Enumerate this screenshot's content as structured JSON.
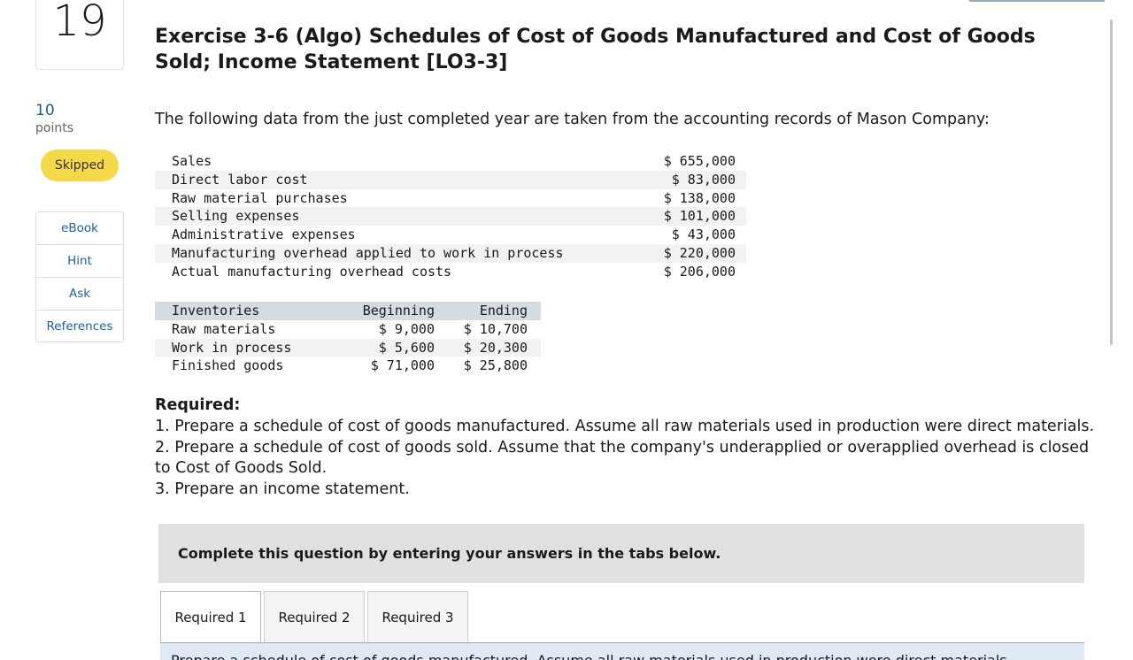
{
  "question": {
    "number": "19",
    "points_value": "10",
    "points_label": "points",
    "status": "Skipped"
  },
  "sidebar": {
    "links": [
      {
        "label": "eBook"
      },
      {
        "label": "Hint"
      },
      {
        "label": "Ask"
      },
      {
        "label": "References"
      }
    ]
  },
  "title": "Exercise 3-6 (Algo) Schedules of Cost of Goods Manufactured and Cost of Goods Sold; Income Statement [LO3-3]",
  "intro": "The following data from the just completed year are taken from the accounting records of Mason Company:",
  "data_rows": [
    {
      "label": "Sales",
      "value": "$ 655,000"
    },
    {
      "label": "Direct labor cost",
      "value": "$ 83,000"
    },
    {
      "label": "Raw material purchases",
      "value": "$ 138,000"
    },
    {
      "label": "Selling expenses",
      "value": "$ 101,000"
    },
    {
      "label": "Administrative expenses",
      "value": "$ 43,000"
    },
    {
      "label": "Manufacturing overhead applied to work in process",
      "value": "$ 220,000"
    },
    {
      "label": "Actual manufacturing overhead costs",
      "value": "$ 206,000"
    }
  ],
  "inventories": {
    "headers": [
      "Inventories",
      "Beginning",
      "Ending"
    ],
    "rows": [
      [
        "Raw materials",
        "$ 9,000",
        "$ 10,700"
      ],
      [
        "Work in process",
        "$ 5,600",
        "$ 20,300"
      ],
      [
        "Finished goods",
        "$ 71,000",
        "$ 25,800"
      ]
    ]
  },
  "required": {
    "heading": "Required:",
    "items": [
      "1. Prepare a schedule of cost of goods manufactured. Assume all raw materials used in production were direct materials.",
      "2. Prepare a schedule of cost of goods sold. Assume that the company's underapplied or overapplied overhead is closed to Cost of Goods Sold.",
      "3. Prepare an income statement."
    ]
  },
  "instructions": "Complete this question by entering your answers in the tabs below.",
  "tabs": [
    {
      "label": "Required 1",
      "active": true
    },
    {
      "label": "Required 2",
      "active": false
    },
    {
      "label": "Required 3",
      "active": false
    }
  ],
  "panel_text": "Prepare a schedule of cost of goods manufactured. Assume all raw materials used in production were direct materials."
}
